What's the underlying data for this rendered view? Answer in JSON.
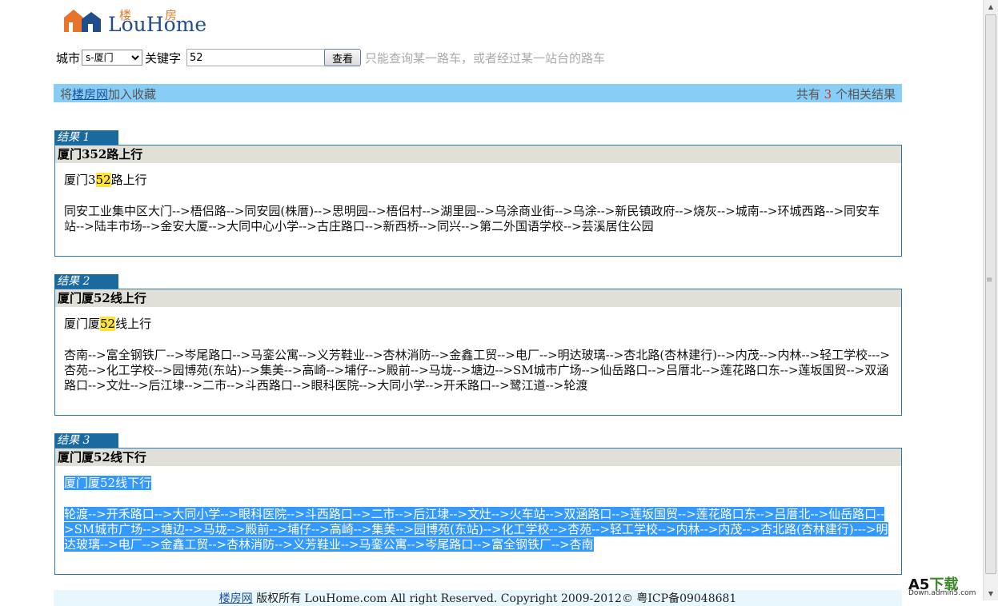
{
  "logo": {
    "chinese": "楼房",
    "english_lo": "Lou",
    "english_home": "Home"
  },
  "search": {
    "city_label": "城市",
    "city_selected": "s-厦门",
    "keyword_label": "关键字",
    "keyword_value": "52",
    "button_label": "查看",
    "hint": "只能查询某一路车，或者经过某一站台的路车"
  },
  "infobar": {
    "left_pre": "将",
    "left_link": "楼房网",
    "left_post": "加入收藏",
    "right_pre": "共有",
    "right_count": "3",
    "right_post": "个相关结果"
  },
  "results": [
    {
      "tag": "结果 1",
      "title": "厦门352路上行",
      "sub_pre": "厦门3",
      "sub_hl": "52",
      "sub_post": "路上行",
      "route": "同安工业集中区大门-->梧侣路-->同安园(株厝)-->思明园-->梧侣村-->湖里园-->乌涂商业街-->乌涂-->新民镇政府-->烧灰-->城南-->环城西路-->同安车站-->陆丰市场-->金安大厦-->大同中心小学-->古庄路口-->新西桥-->同兴-->第二外国语学校-->芸溪居住公园"
    },
    {
      "tag": "结果 2",
      "title": "厦门厦52线上行",
      "sub_pre": "厦门厦",
      "sub_hl": "52",
      "sub_post": "线上行",
      "route": "杏南-->富全钢铁厂-->岑尾路口-->马銮公寓-->义芳鞋业-->杏林消防-->金鑫工贸-->电厂-->明达玻璃-->杏北路(杏林建行)-->内茂-->内林-->轻工学校--->杏苑-->化工学校-->园博苑(东站)-->集美-->高崎-->埔仔-->殿前-->马垅-->塘边-->SM城市广场-->仙岳路口-->吕厝北-->莲花路口东-->莲坂国贸-->双涵路口-->文灶-->后江埭-->二市-->斗西路口-->眼科医院-->大同小学-->开禾路口-->鹭江道-->轮渡"
    },
    {
      "tag": "结果 3",
      "title": "厦门厦52线下行",
      "sub_full": "厦门厦52线下行",
      "route": "轮渡-->开禾路口-->大同小学-->眼科医院-->斗西路口-->二市-->后江埭-->文灶-->火车站-->双涵路口-->莲坂国贸-->莲花路口东-->吕厝北-->仙岳路口-->SM城市广场-->塘边-->马垅-->殿前-->埔仔-->高崎-->集美-->园博苑(东站)-->化工学校-->杏苑-->轻工学校-->内林-->内茂-->杏北路(杏林建行)--->明达玻璃-->电厂-->金鑫工贸-->杏林消防-->义芳鞋业-->马銮公寓-->岑尾路口-->富全钢铁厂-->杏南"
    }
  ],
  "footer": {
    "link": "楼房网",
    "text": "版权所有 LouHome.com All right Reserved. Copyright 2009-2012© 粤ICP备09048681"
  },
  "watermark": {
    "brand_a5": "A5",
    "brand_cn": "下载",
    "url": "Down.admin5.com"
  },
  "icons": {
    "logo": "houses-logo-icon",
    "select_arrow": "chevron-down-icon",
    "scroll_up": "arrow-up-icon",
    "scroll_down": "arrow-down-icon"
  }
}
